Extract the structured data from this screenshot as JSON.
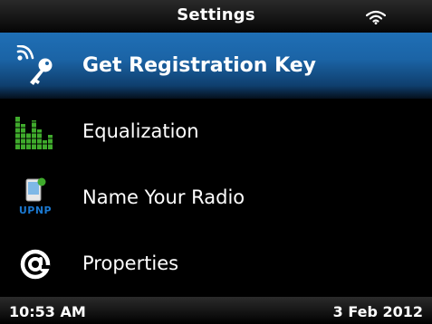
{
  "header": {
    "title": "Settings",
    "signal_icon": "wifi-icon"
  },
  "menu": {
    "items": [
      {
        "label": "Get Registration Key",
        "icon": "registration-key-icon",
        "selected": true
      },
      {
        "label": "Equalization",
        "icon": "equalizer-icon",
        "selected": false
      },
      {
        "label": "Name Your Radio",
        "icon": "upnp-icon",
        "icon_text": "UPNP",
        "selected": false
      },
      {
        "label": "Properties",
        "icon": "at-sign-icon",
        "selected": false
      }
    ]
  },
  "status": {
    "time": "10:53 AM",
    "date": "3 Feb 2012"
  },
  "colors": {
    "selection": "#1b64a6",
    "equalizer": "#3faa2c",
    "upnp": "#1b79d1",
    "background": "#000000"
  }
}
